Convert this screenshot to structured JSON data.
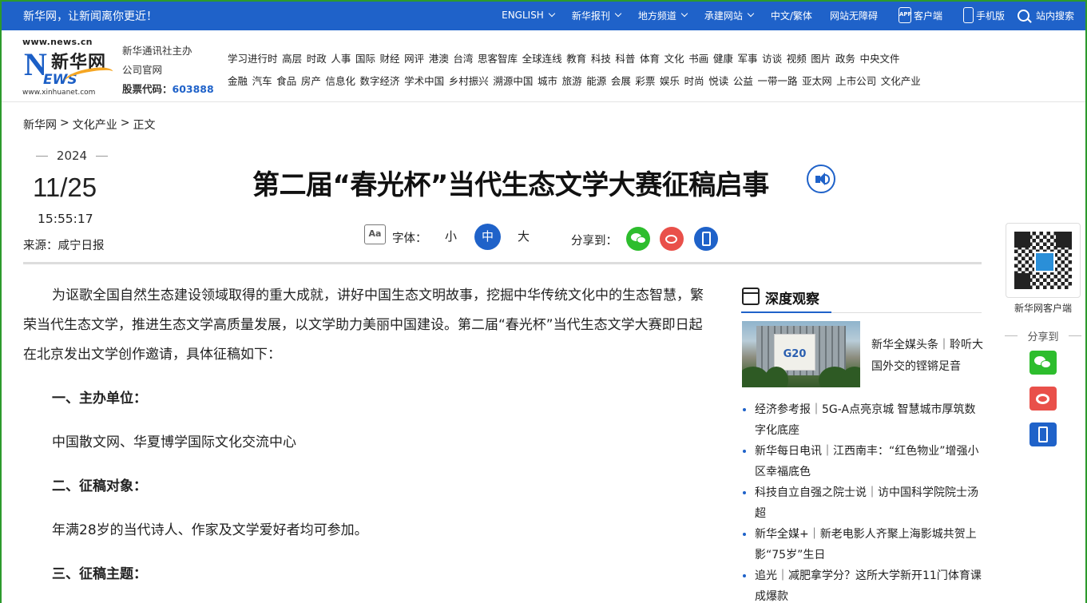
{
  "topbar": {
    "slogan": "新华网，让新闻离你更近！",
    "nav": [
      {
        "label": "ENGLISH",
        "dropdown": true
      },
      {
        "label": "新华报刊",
        "dropdown": true
      },
      {
        "label": "地方频道",
        "dropdown": true
      },
      {
        "label": "承建网站",
        "dropdown": true
      },
      {
        "label": "中文/繁体",
        "dropdown": false
      },
      {
        "label": "网站无障碍",
        "dropdown": false
      }
    ],
    "client_label": "客户端",
    "app_badge": "APP",
    "mobile_label": "手机版",
    "search_label": "站内搜索"
  },
  "header": {
    "logo_url_top": "www.news.cn",
    "logo_mark": "N",
    "logo_cn": "新华网",
    "logo_ews": "EWS",
    "logo_url_bottom": "www.xinhuanet.com",
    "corp_line1": "新华通讯社主办",
    "corp_line2": "公司官网",
    "stock_label": "股票代码：",
    "stock_code": "603888",
    "channels_row1": [
      "学习进行时",
      "高层",
      "时政",
      "人事",
      "国际",
      "财经",
      "网评",
      "港澳",
      "台湾",
      "思客智库",
      "全球连线",
      "教育",
      "科技",
      "科普",
      "体育",
      "文化",
      "书画",
      "健康",
      "军事",
      "访谈",
      "视频",
      "图片",
      "政务",
      "中央文件"
    ],
    "channels_row2": [
      "金融",
      "汽车",
      "食品",
      "房产",
      "信息化",
      "数字经济",
      "学术中国",
      "乡村振兴",
      "溯源中国",
      "城市",
      "旅游",
      "能源",
      "会展",
      "彩票",
      "娱乐",
      "时尚",
      "悦读",
      "公益",
      "一带一路",
      "亚太网",
      "上市公司",
      "文化产业"
    ]
  },
  "breadcrumb": [
    "新华网",
    ">",
    "文化产业",
    ">",
    "正文"
  ],
  "date": {
    "year": "2024",
    "month_day": "11/25",
    "time": "15:55:17"
  },
  "source": "来源：咸宁日报",
  "title": "第二届“春光杯”当代生态文学大赛征稿启事",
  "tools": {
    "font_label": "字体：",
    "sizes": [
      {
        "label": "小",
        "active": false
      },
      {
        "label": "中",
        "active": true
      },
      {
        "label": "大",
        "active": false
      }
    ],
    "share_label": "分享到："
  },
  "article": {
    "lead": "为讴歌全国自然生态建设领域取得的重大成就，讲好中国生态文明故事，挖掘中华传统文化中的生态智慧，繁荣当代生态文学，推进生态文学高质量发展，以文学助力美丽中国建设。第二届“春光杯”当代生态文学大赛即日起在北京发出文学创作邀请，具体征稿如下：",
    "h1": "一、主办单位：",
    "t1": "中国散文网、华夏博学国际文化交流中心",
    "h2": "二、征稿对象：",
    "t2": "年满28岁的当代诗人、作家及文学爱好者均可参加。",
    "h3": "三、征稿主题："
  },
  "sidebar": {
    "heading": "深度观察",
    "feature_image_text": "G20",
    "feature_title": "新华全媒头条｜聆听大国外交的铿锵足音",
    "news": [
      "经济参考报｜5G-A点亮京城 智慧城市厚筑数字化底座",
      "新华每日电讯｜江西南丰：“红色物业”增强小区幸福底色",
      "科技自立自强之院士说｜访中国科学院院士汤超",
      "新华全媒+｜新老电影人齐聚上海影城共贺上影“75岁”生日",
      "追光｜减肥拿学分？这所大学新开11门体育课成爆款"
    ]
  },
  "float": {
    "qr_label": "新华网客户端",
    "share_label": "分享到"
  },
  "colors": {
    "brand_blue": "#1f62c9",
    "wechat_green": "#2dbd2d",
    "weibo_red": "#e9504a",
    "logo_orange": "#f5a623"
  }
}
